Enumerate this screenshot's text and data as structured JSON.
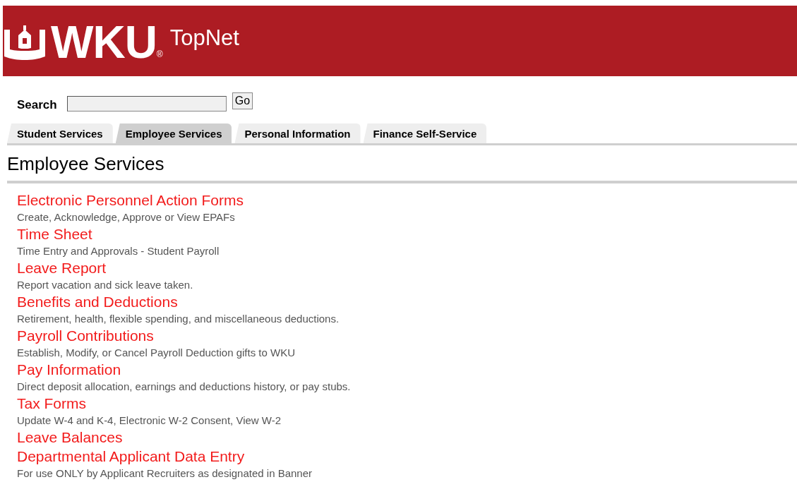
{
  "header": {
    "logo_text": "WKU",
    "logo_mark": "®",
    "app_title": "TopNet"
  },
  "search": {
    "label": "Search",
    "button": "Go"
  },
  "tabs": [
    {
      "label": "Student Services",
      "selected": false
    },
    {
      "label": "Employee Services",
      "selected": true
    },
    {
      "label": "Personal Information",
      "selected": false
    },
    {
      "label": "Finance Self-Service",
      "selected": false
    }
  ],
  "page_title": "Employee Services",
  "links": [
    {
      "title": "Electronic Personnel Action Forms",
      "description": "Create, Acknowledge, Approve or View EPAFs"
    },
    {
      "title": "Time Sheet",
      "description": "Time Entry and Approvals - Student Payroll"
    },
    {
      "title": "Leave Report",
      "description": "Report vacation and sick leave taken."
    },
    {
      "title": "Benefits and Deductions",
      "description": "Retirement, health, flexible spending, and miscellaneous deductions."
    },
    {
      "title": "Payroll Contributions",
      "description": "Establish, Modify, or Cancel Payroll Deduction gifts to WKU"
    },
    {
      "title": "Pay Information",
      "description": "Direct deposit allocation, earnings and deductions history, or pay stubs."
    },
    {
      "title": "Tax Forms",
      "description": "Update W-4 and K-4, Electronic W-2 Consent, View W-2"
    },
    {
      "title": "Leave Balances"
    },
    {
      "title": "Departmental Applicant Data Entry",
      "description": "For use ONLY by Applicant Recruiters as designated in Banner"
    }
  ]
}
